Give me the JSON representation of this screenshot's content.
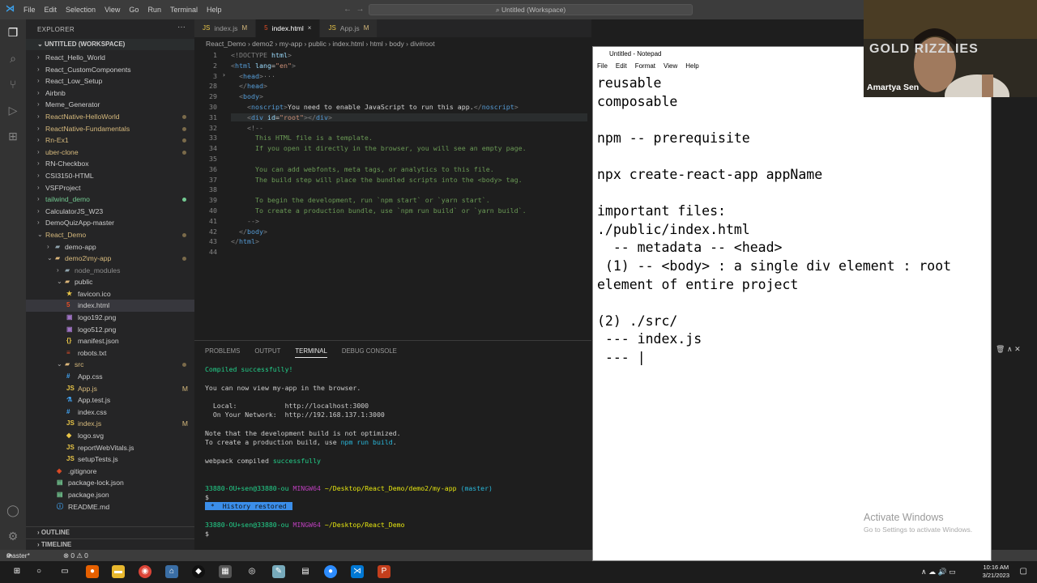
{
  "window": {
    "menu": [
      "File",
      "Edit",
      "Selection",
      "View",
      "Go",
      "Run",
      "Terminal",
      "Help"
    ],
    "search": "Untitled (Workspace)"
  },
  "sidebar": {
    "title": "EXPLORER",
    "workspace": "UNTITLED (WORKSPACE)",
    "items": [
      {
        "label": "React_Hello_World",
        "depth": 0,
        "type": "folder",
        "open": false,
        "color": "#cccccc"
      },
      {
        "label": "React_CustomComponents",
        "depth": 0,
        "type": "folder",
        "open": false,
        "color": "#cccccc"
      },
      {
        "label": "React_Low_Setup",
        "depth": 0,
        "type": "folder",
        "open": false,
        "color": "#cccccc"
      },
      {
        "label": "Airbnb",
        "depth": 0,
        "type": "folder",
        "open": false,
        "color": "#cccccc"
      },
      {
        "label": "Meme_Generator",
        "depth": 0,
        "type": "folder",
        "open": false,
        "color": "#cccccc"
      },
      {
        "label": "ReactNative-HelloWorld",
        "depth": 0,
        "type": "folder",
        "open": false,
        "color": "#d7ba7d",
        "dot": true
      },
      {
        "label": "ReactNative-Fundamentals",
        "depth": 0,
        "type": "folder",
        "open": false,
        "color": "#d7ba7d",
        "dot": true
      },
      {
        "label": "Rn-Ex1",
        "depth": 0,
        "type": "folder",
        "open": false,
        "color": "#d7ba7d",
        "dot": true
      },
      {
        "label": "uber-clone",
        "depth": 0,
        "type": "folder",
        "open": false,
        "color": "#d7ba7d",
        "dot": true
      },
      {
        "label": "RN-Checkbox",
        "depth": 0,
        "type": "folder",
        "open": false,
        "color": "#cccccc"
      },
      {
        "label": "CSI3150-HTML",
        "depth": 0,
        "type": "folder",
        "open": false,
        "color": "#cccccc"
      },
      {
        "label": "VSFProject",
        "depth": 0,
        "type": "folder",
        "open": false,
        "color": "#cccccc"
      },
      {
        "label": "tailwind_demo",
        "depth": 0,
        "type": "folder",
        "open": false,
        "color": "#73c991",
        "dot": true
      },
      {
        "label": "CalculatorJS_W23",
        "depth": 0,
        "type": "folder",
        "open": false,
        "color": "#cccccc"
      },
      {
        "label": "DemoQuizApp-master",
        "depth": 0,
        "type": "folder",
        "open": false,
        "color": "#cccccc"
      },
      {
        "label": "React_Demo",
        "depth": 0,
        "type": "folder",
        "open": true,
        "color": "#d7ba7d",
        "dot": true
      },
      {
        "label": "demo-app",
        "depth": 1,
        "type": "folder",
        "open": false,
        "color": "#cccccc"
      },
      {
        "label": "demo2\\my-app",
        "depth": 1,
        "type": "folder",
        "open": true,
        "color": "#d7ba7d",
        "dot": true
      },
      {
        "label": "node_modules",
        "depth": 2,
        "type": "folder",
        "open": false,
        "color": "#8c8c8c"
      },
      {
        "label": "public",
        "depth": 2,
        "type": "folder",
        "open": true,
        "color": "#cccccc"
      },
      {
        "label": "favicon.ico",
        "depth": 3,
        "type": "file",
        "icon": "★",
        "iconColor": "#e8c547",
        "color": "#cccccc"
      },
      {
        "label": "index.html",
        "depth": 3,
        "type": "file",
        "icon": "5",
        "iconColor": "#e44d26",
        "color": "#cccccc",
        "selected": true
      },
      {
        "label": "logo192.png",
        "depth": 3,
        "type": "file",
        "icon": "▣",
        "iconColor": "#a074c4",
        "color": "#cccccc"
      },
      {
        "label": "logo512.png",
        "depth": 3,
        "type": "file",
        "icon": "▣",
        "iconColor": "#a074c4",
        "color": "#cccccc"
      },
      {
        "label": "manifest.json",
        "depth": 3,
        "type": "file",
        "icon": "{}",
        "iconColor": "#e8c547",
        "color": "#cccccc"
      },
      {
        "label": "robots.txt",
        "depth": 3,
        "type": "file",
        "icon": "≡",
        "iconColor": "#e44d26",
        "color": "#cccccc"
      },
      {
        "label": "src",
        "depth": 2,
        "type": "folder",
        "open": true,
        "color": "#d7ba7d",
        "dot": true
      },
      {
        "label": "App.css",
        "depth": 3,
        "type": "file",
        "icon": "#",
        "iconColor": "#42a5f5",
        "color": "#cccccc"
      },
      {
        "label": "App.js",
        "depth": 3,
        "type": "file",
        "icon": "JS",
        "iconColor": "#e8c547",
        "color": "#d7ba7d",
        "mod": "M"
      },
      {
        "label": "App.test.js",
        "depth": 3,
        "type": "file",
        "icon": "⚗",
        "iconColor": "#42a5f5",
        "color": "#cccccc"
      },
      {
        "label": "index.css",
        "depth": 3,
        "type": "file",
        "icon": "#",
        "iconColor": "#42a5f5",
        "color": "#cccccc"
      },
      {
        "label": "index.js",
        "depth": 3,
        "type": "file",
        "icon": "JS",
        "iconColor": "#e8c547",
        "color": "#d7ba7d",
        "mod": "M"
      },
      {
        "label": "logo.svg",
        "depth": 3,
        "type": "file",
        "icon": "◆",
        "iconColor": "#e8c547",
        "color": "#cccccc"
      },
      {
        "label": "reportWebVitals.js",
        "depth": 3,
        "type": "file",
        "icon": "JS",
        "iconColor": "#e8c547",
        "color": "#cccccc"
      },
      {
        "label": "setupTests.js",
        "depth": 3,
        "type": "file",
        "icon": "JS",
        "iconColor": "#e8c547",
        "color": "#cccccc"
      },
      {
        "label": ".gitignore",
        "depth": 2,
        "type": "file",
        "icon": "◈",
        "iconColor": "#e44d26",
        "color": "#cccccc"
      },
      {
        "label": "package-lock.json",
        "depth": 2,
        "type": "file",
        "icon": "▤",
        "iconColor": "#73c991",
        "color": "#cccccc"
      },
      {
        "label": "package.json",
        "depth": 2,
        "type": "file",
        "icon": "▤",
        "iconColor": "#73c991",
        "color": "#cccccc"
      },
      {
        "label": "README.md",
        "depth": 2,
        "type": "file",
        "icon": "ⓘ",
        "iconColor": "#42a5f5",
        "color": "#cccccc"
      }
    ],
    "outline": "OUTLINE",
    "timeline": "TIMELINE"
  },
  "tabs": [
    {
      "label": "index.js",
      "kind": "js",
      "mod": "M",
      "active": false
    },
    {
      "label": "index.html",
      "kind": "html",
      "mod": "×",
      "active": true
    },
    {
      "label": "App.js",
      "kind": "js",
      "mod": "M",
      "active": false
    }
  ],
  "breadcrumb": [
    "React_Demo",
    "demo2",
    "my-app",
    "public",
    "index.html",
    "html",
    "body",
    "div#root"
  ],
  "editor": {
    "lines": [
      {
        "n": "1",
        "html": "<span class='g'>&lt;!DOCTYPE</span> <span class='a'>html</span><span class='g'>&gt;</span>"
      },
      {
        "n": "2",
        "html": "<span class='g'>&lt;</span><span class='t'>html</span> <span class='a'>lang</span>=<span class='s'>\"en\"</span><span class='g'>&gt;</span>"
      },
      {
        "n": "3",
        "html": "  <span class='g'>&lt;</span><span class='t'>head</span><span class='g'>&gt;</span><span class='g'>···</span>"
      },
      {
        "n": "28",
        "html": "  <span class='g'>&lt;/</span><span class='t'>head</span><span class='g'>&gt;</span>"
      },
      {
        "n": "29",
        "html": "  <span class='g'>&lt;</span><span class='t'>body</span><span class='g'>&gt;</span>"
      },
      {
        "n": "30",
        "html": "    <span class='g'>&lt;</span><span class='t'>noscript</span><span class='g'>&gt;</span>You need to enable JavaScript to run this app.<span class='g'>&lt;/</span><span class='t'>noscript</span><span class='g'>&gt;</span>"
      },
      {
        "n": "31",
        "html": "    <span class='g'>&lt;</span><span class='t'>div</span> <span class='a'>id</span>=<span class='s'>\"root\"</span><span class='g'>&gt;&lt;/</span><span class='t'>div</span><span class='g'>&gt;</span>"
      },
      {
        "n": "32",
        "html": "    <span class='g'>&lt;!--</span>"
      },
      {
        "n": "33",
        "html": "<span class='c'>      This HTML file is a template.</span>"
      },
      {
        "n": "34",
        "html": "<span class='c'>      If you open it directly in the browser, you will see an empty page.</span>"
      },
      {
        "n": "35",
        "html": ""
      },
      {
        "n": "36",
        "html": "<span class='c'>      You can add webfonts, meta tags, or analytics to this file.</span>"
      },
      {
        "n": "37",
        "html": "<span class='c'>      The build step will place the bundled scripts into the &lt;body&gt; tag.</span>"
      },
      {
        "n": "38",
        "html": ""
      },
      {
        "n": "39",
        "html": "<span class='c'>      To begin the development, run `npm start` or `yarn start`.</span>"
      },
      {
        "n": "40",
        "html": "<span class='c'>      To create a production bundle, use `npm run build` or `yarn build`.</span>"
      },
      {
        "n": "41",
        "html": "    <span class='g'>--&gt;</span>"
      },
      {
        "n": "42",
        "html": "  <span class='g'>&lt;/</span><span class='t'>body</span><span class='g'>&gt;</span>"
      },
      {
        "n": "43",
        "html": "<span class='g'>&lt;/</span><span class='t'>html</span><span class='g'>&gt;</span>"
      },
      {
        "n": "44",
        "html": ""
      }
    ]
  },
  "panel": {
    "tabs": [
      "PROBLEMS",
      "OUTPUT",
      "TERMINAL",
      "DEBUG CONSOLE"
    ],
    "active": "TERMINAL",
    "terminal": {
      "compiled": "Compiled successfully!",
      "view": "You can now view my-app in the browser.",
      "local_label": "  Local:",
      "local_url": "http://localhost:3000",
      "network_label": "  On Your Network:",
      "network_url": "http://192.168.137.1:3000",
      "note1": "Note that the development build is not optimized.",
      "note2a": "To create a production build, use ",
      "note2b": "npm run build",
      "webpack": "webpack compiled ",
      "webpack_ok": "successfully",
      "prompt_user": "33880-OU+sen@33880-ou",
      "prompt_sys": "MINGW64",
      "prompt_path1": "~/Desktop/React_Demo/demo2/my-app",
      "prompt_branch": "(master)",
      "dollar": "$",
      "history": " *  History restored ",
      "prompt_path2": "~/Desktop/React_Demo"
    }
  },
  "status": {
    "branch": "master*",
    "errors": "⊗ 0 ⚠ 0"
  },
  "notepad": {
    "title": "Untitled - Notepad",
    "menu": [
      "File",
      "Edit",
      "Format",
      "View",
      "Help"
    ],
    "text": "reusable\ncomposable\n\nnpm -- prerequisite\n\nnpx create-react-app appName\n\nimportant files:\n./public/index.html\n  -- metadata -- <head>\n (1) -- <body> : a single div element : root element of entire project\n\n(2) ./src/\n --- index.js\n --- ",
    "watermark": "Activate Windows",
    "watermark_sub": "Go to Settings to activate Windows."
  },
  "webcam": {
    "name": "Amartya Sen",
    "banner": "GOLD   RIZZLIES"
  },
  "taskbar": {
    "time": "10:16 AM",
    "date": "3/21/2023"
  }
}
